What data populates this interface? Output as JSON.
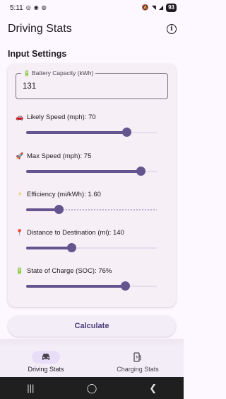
{
  "status_bar": {
    "time": "5:11",
    "battery": "93"
  },
  "app_bar": {
    "title": "Driving Stats",
    "info_icon": "info-icon"
  },
  "section_title": "Input Settings",
  "battery_field": {
    "label": "Battery Capacity (kWh)",
    "icon": "battery-icon",
    "value": "131"
  },
  "sliders": [
    {
      "icon": "car-icon",
      "label": "Likely Speed (mph): 70",
      "fraction": 0.77
    },
    {
      "icon": "rocket-icon",
      "label": "Max Speed (mph): 75",
      "fraction": 0.88
    },
    {
      "icon": "lightning-icon",
      "label": "Efficiency (mi/kWh): 1.60",
      "fraction": 0.25
    },
    {
      "icon": "pin-icon",
      "label": "Distance to Destination (mi): 140",
      "fraction": 0.35
    },
    {
      "icon": "battery-icon",
      "label": "State of Charge (SOC): 76%",
      "fraction": 0.76
    }
  ],
  "calculate_label": "Calculate",
  "bottom_nav": [
    {
      "label": "Driving Stats",
      "icon": "car-icon",
      "active": true
    },
    {
      "label": "Charging Stats",
      "icon": "ev-charger-icon",
      "active": false
    }
  ],
  "colors": {
    "primary": "#65558f",
    "track": "#e3dceb",
    "background": "#fdf7ff",
    "card": "#f6eff6"
  }
}
